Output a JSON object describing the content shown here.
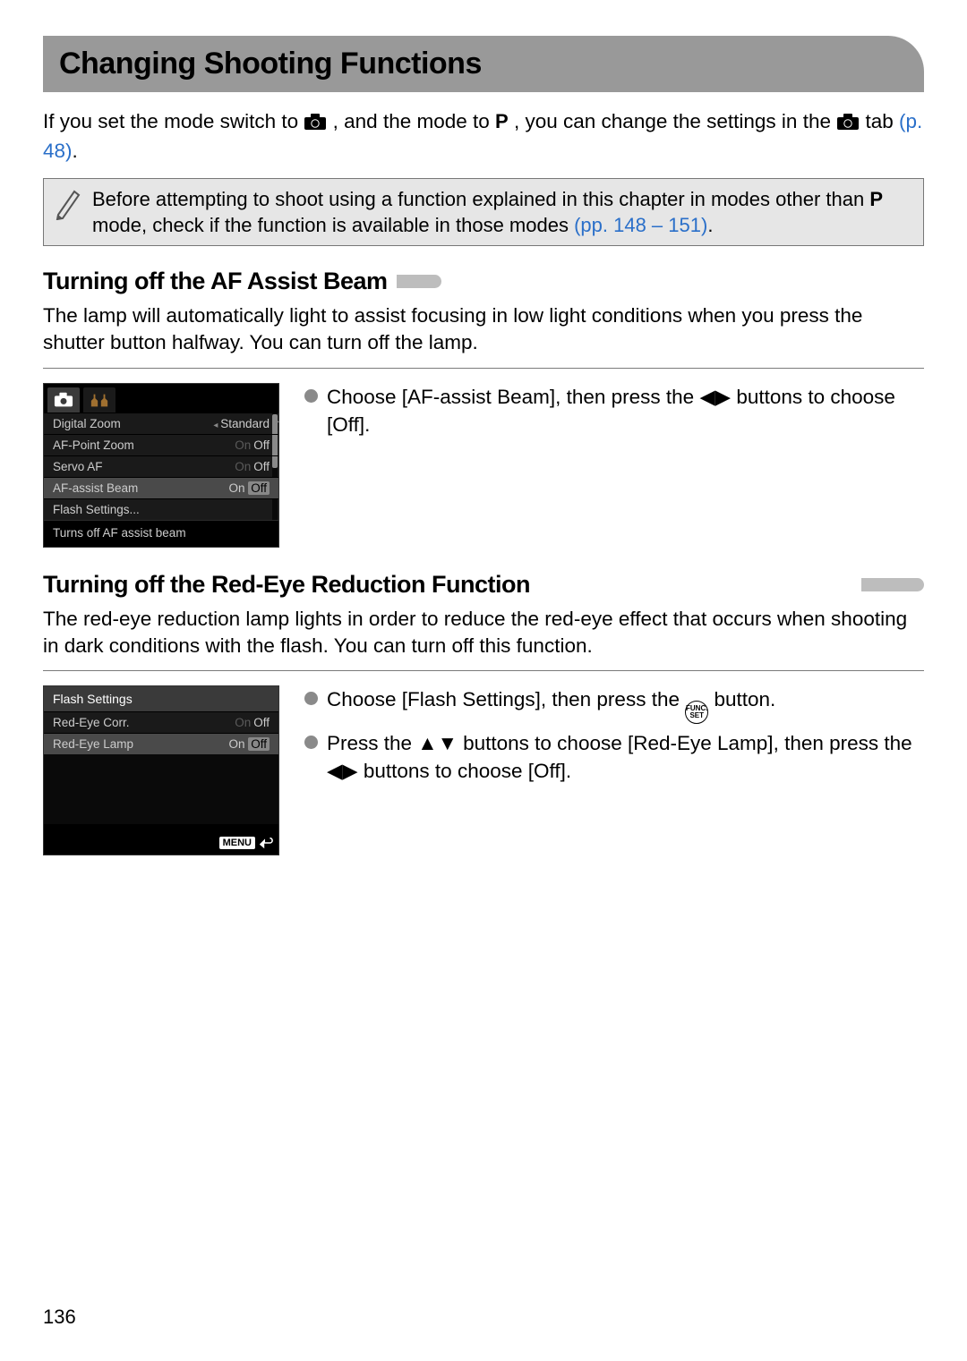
{
  "page_title": "Changing Shooting Functions",
  "intro": {
    "p1_a": "If you set the mode switch to ",
    "p1_b": ", and the mode to ",
    "p1_c": ", you can change the settings in the ",
    "p1_d": " tab ",
    "link1": "(p. 48)",
    "period": "."
  },
  "note": {
    "a": "Before attempting to shoot using a function explained in this chapter in modes other than ",
    "b": " mode, check if the function is available in those modes ",
    "link": "(pp. 148 – 151)",
    "period": "."
  },
  "section1": {
    "title": "Turning off the AF Assist Beam",
    "body": "The lamp will automatically light to assist focusing in low light conditions when you press the shutter button halfway. You can turn off the lamp."
  },
  "lcd1": {
    "rows": [
      {
        "label": "Digital Zoom",
        "on": "",
        "val_prefix": "◂ ",
        "val": "Standard",
        "val_suffix": "",
        "sel": false,
        "arrow_right": true
      },
      {
        "label": "AF-Point Zoom",
        "on": "On",
        "val": "Off",
        "sel": false
      },
      {
        "label": "Servo AF",
        "on": "On",
        "val": "Off",
        "sel": false
      },
      {
        "label": "AF-assist Beam",
        "on": "On",
        "val": "Off",
        "sel": true,
        "hl": true
      },
      {
        "label": "Flash Settings...",
        "on": "",
        "val": "",
        "sel": false
      }
    ],
    "status": "Turns off AF assist beam"
  },
  "instr1": {
    "a": "Choose [AF-assist Beam], then press the ",
    "b": " buttons to choose [Off]."
  },
  "section2": {
    "title": "Turning off the Red-Eye Reduction Function",
    "body": "The red-eye reduction lamp lights in order to reduce the red-eye effect that occurs when shooting in dark conditions with the flash. You can turn off this function."
  },
  "lcd2": {
    "title": "Flash Settings",
    "rows": [
      {
        "label": "Red-Eye Corr.",
        "on": "On",
        "val": "Off",
        "sel": false
      },
      {
        "label": "Red-Eye Lamp",
        "on": "On",
        "val": "Off",
        "sel": true,
        "hl": true
      }
    ],
    "menu": "MENU"
  },
  "instr2a": {
    "a": "Choose [Flash Settings], then press the ",
    "b": " button."
  },
  "instr2b": {
    "a": "Press the ",
    "b": " buttons to choose [Red-Eye Lamp], then press the ",
    "c": " buttons to choose [Off]."
  },
  "func_set": "FUNC.\nSET",
  "page_number": "136"
}
